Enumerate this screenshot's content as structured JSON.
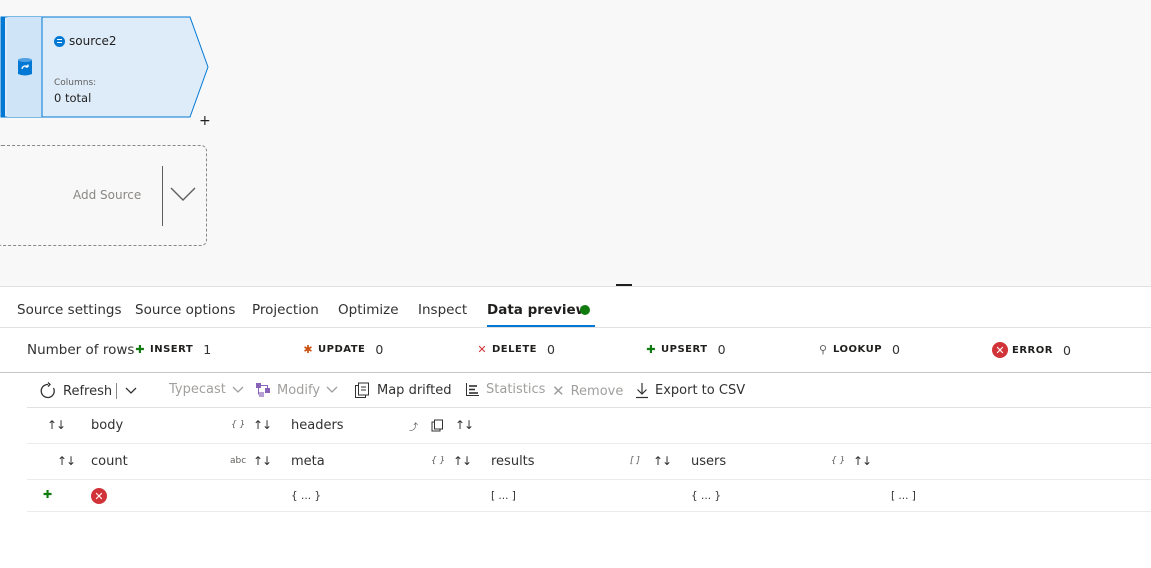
{
  "canvas": {
    "node": {
      "title": "source2",
      "columns_label": "Columns:",
      "columns_value": "0 total",
      "plus": "+"
    },
    "add_source": {
      "label": "Add Source"
    }
  },
  "tabs": [
    {
      "label": "Source settings"
    },
    {
      "label": "Source options"
    },
    {
      "label": "Projection"
    },
    {
      "label": "Optimize"
    },
    {
      "label": "Inspect"
    },
    {
      "label": "Data preview",
      "active": true
    }
  ],
  "stats": {
    "label": "Number of rows",
    "items": [
      {
        "name": "INSERT",
        "value": "1",
        "icon": "plus-icon",
        "color": "#107c10"
      },
      {
        "name": "UPDATE",
        "value": "0",
        "icon": "asterisk-icon",
        "color": "#ca5010"
      },
      {
        "name": "DELETE",
        "value": "0",
        "icon": "x-icon",
        "color": "#d13438"
      },
      {
        "name": "UPSERT",
        "value": "0",
        "icon": "upsert-icon",
        "color": "#107c10"
      },
      {
        "name": "LOOKUP",
        "value": "0",
        "icon": "magnifier-icon",
        "color": "#605e5c"
      },
      {
        "name": "ERROR",
        "value": "0",
        "icon": "error-icon",
        "color": "#d13438"
      }
    ]
  },
  "toolbar": {
    "refresh": "Refresh",
    "typecast": "Typecast",
    "modify": "Modify",
    "map_drifted": "Map drifted",
    "statistics": "Statistics",
    "remove": "Remove",
    "export": "Export to CSV"
  },
  "grid": {
    "header1": {
      "body": "body",
      "body_type": "{ }",
      "headers": "headers"
    },
    "header2": {
      "count": "count",
      "count_type": "abc",
      "meta": "meta",
      "meta_type": "{ }",
      "results": "results",
      "results_type": "[ ]",
      "users": "users",
      "users_type": "{ }"
    },
    "row": {
      "v1": "{ ... }",
      "v2": "[ ... ]",
      "v3": "{ ... }",
      "v4": "[ ... ]"
    }
  },
  "colors": {
    "accent": "#0078d4",
    "success": "#107c10",
    "error": "#d13438"
  }
}
